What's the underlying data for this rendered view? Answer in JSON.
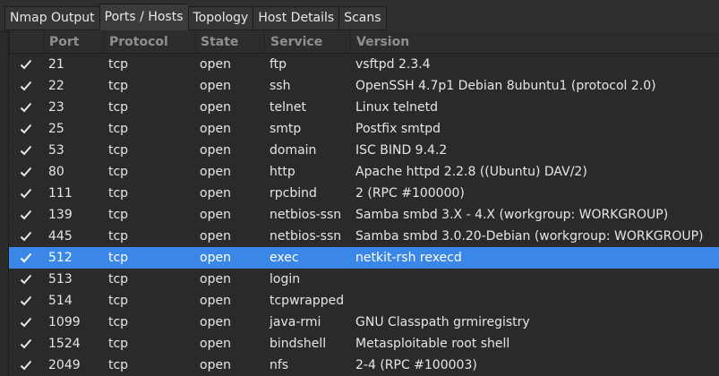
{
  "tabs": [
    {
      "label": "Nmap Output",
      "active": false
    },
    {
      "label": "Ports / Hosts",
      "active": true
    },
    {
      "label": "Topology",
      "active": false
    },
    {
      "label": "Host Details",
      "active": false
    },
    {
      "label": "Scans",
      "active": false
    }
  ],
  "columns": [
    "Port",
    "Protocol",
    "State",
    "Service",
    "Version"
  ],
  "check_icon": "check-icon",
  "selected_color": "#3a87e8",
  "rows": [
    {
      "port": "21",
      "protocol": "tcp",
      "state": "open",
      "service": "ftp",
      "version": "vsftpd 2.3.4"
    },
    {
      "port": "22",
      "protocol": "tcp",
      "state": "open",
      "service": "ssh",
      "version": "OpenSSH 4.7p1 Debian 8ubuntu1 (protocol 2.0)"
    },
    {
      "port": "23",
      "protocol": "tcp",
      "state": "open",
      "service": "telnet",
      "version": "Linux telnetd"
    },
    {
      "port": "25",
      "protocol": "tcp",
      "state": "open",
      "service": "smtp",
      "version": "Postfix smtpd"
    },
    {
      "port": "53",
      "protocol": "tcp",
      "state": "open",
      "service": "domain",
      "version": "ISC BIND 9.4.2"
    },
    {
      "port": "80",
      "protocol": "tcp",
      "state": "open",
      "service": "http",
      "version": "Apache httpd 2.2.8 ((Ubuntu) DAV/2)"
    },
    {
      "port": "111",
      "protocol": "tcp",
      "state": "open",
      "service": "rpcbind",
      "version": "2 (RPC #100000)"
    },
    {
      "port": "139",
      "protocol": "tcp",
      "state": "open",
      "service": "netbios-ssn",
      "version": "Samba smbd 3.X - 4.X (workgroup: WORKGROUP)"
    },
    {
      "port": "445",
      "protocol": "tcp",
      "state": "open",
      "service": "netbios-ssn",
      "version": "Samba smbd 3.0.20-Debian (workgroup: WORKGROUP)"
    },
    {
      "port": "512",
      "protocol": "tcp",
      "state": "open",
      "service": "exec",
      "version": "netkit-rsh rexecd",
      "selected": true
    },
    {
      "port": "513",
      "protocol": "tcp",
      "state": "open",
      "service": "login",
      "version": ""
    },
    {
      "port": "514",
      "protocol": "tcp",
      "state": "open",
      "service": "tcpwrapped",
      "version": ""
    },
    {
      "port": "1099",
      "protocol": "tcp",
      "state": "open",
      "service": "java-rmi",
      "version": "GNU Classpath grmiregistry"
    },
    {
      "port": "1524",
      "protocol": "tcp",
      "state": "open",
      "service": "bindshell",
      "version": "Metasploitable root shell"
    },
    {
      "port": "2049",
      "protocol": "tcp",
      "state": "open",
      "service": "nfs",
      "version": "2-4 (RPC #100003)"
    }
  ]
}
